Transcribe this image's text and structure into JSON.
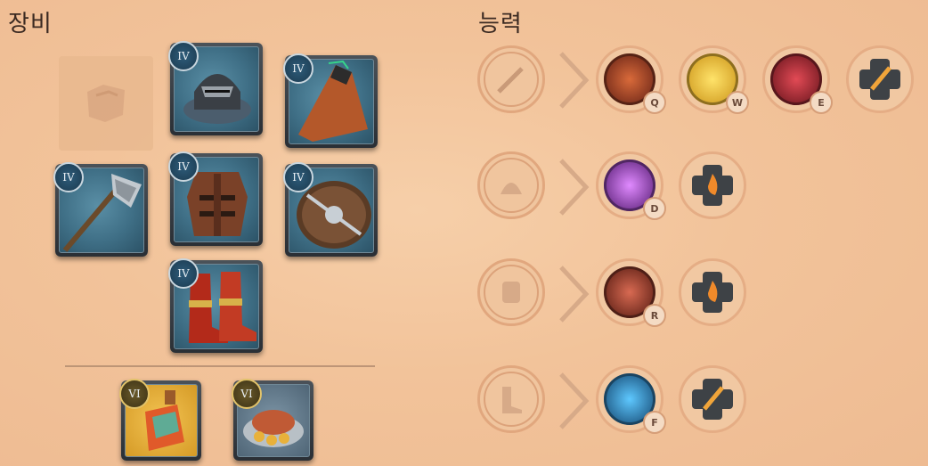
{
  "equipment": {
    "title": "장비",
    "slots": [
      {
        "id": "head",
        "tier": "IV"
      },
      {
        "id": "cape",
        "tier": "IV"
      },
      {
        "id": "weapon",
        "tier": "IV"
      },
      {
        "id": "chest",
        "tier": "IV"
      },
      {
        "id": "offhand",
        "tier": "IV"
      },
      {
        "id": "shoes",
        "tier": "IV"
      },
      {
        "id": "potion",
        "tier": "VI"
      },
      {
        "id": "food",
        "tier": "VI"
      }
    ]
  },
  "abilities": {
    "title": "능력",
    "rows": [
      {
        "slot": "weapon",
        "spells": [
          {
            "key": "Q",
            "color": "#b3462a"
          },
          {
            "key": "W",
            "color": "#e2b420"
          },
          {
            "key": "E",
            "color": "#a81f2a"
          }
        ],
        "passive_extra": "sword"
      },
      {
        "slot": "head",
        "spells": [
          {
            "key": "D",
            "color": "#8a2fbf"
          }
        ],
        "passive_extra": "fire"
      },
      {
        "slot": "chest",
        "spells": [
          {
            "key": "R",
            "color": "#a53a2a"
          }
        ],
        "passive_extra": "fire"
      },
      {
        "slot": "shoes",
        "spells": [
          {
            "key": "F",
            "color": "#1f6fa3"
          }
        ],
        "passive_extra": "sword"
      }
    ]
  }
}
